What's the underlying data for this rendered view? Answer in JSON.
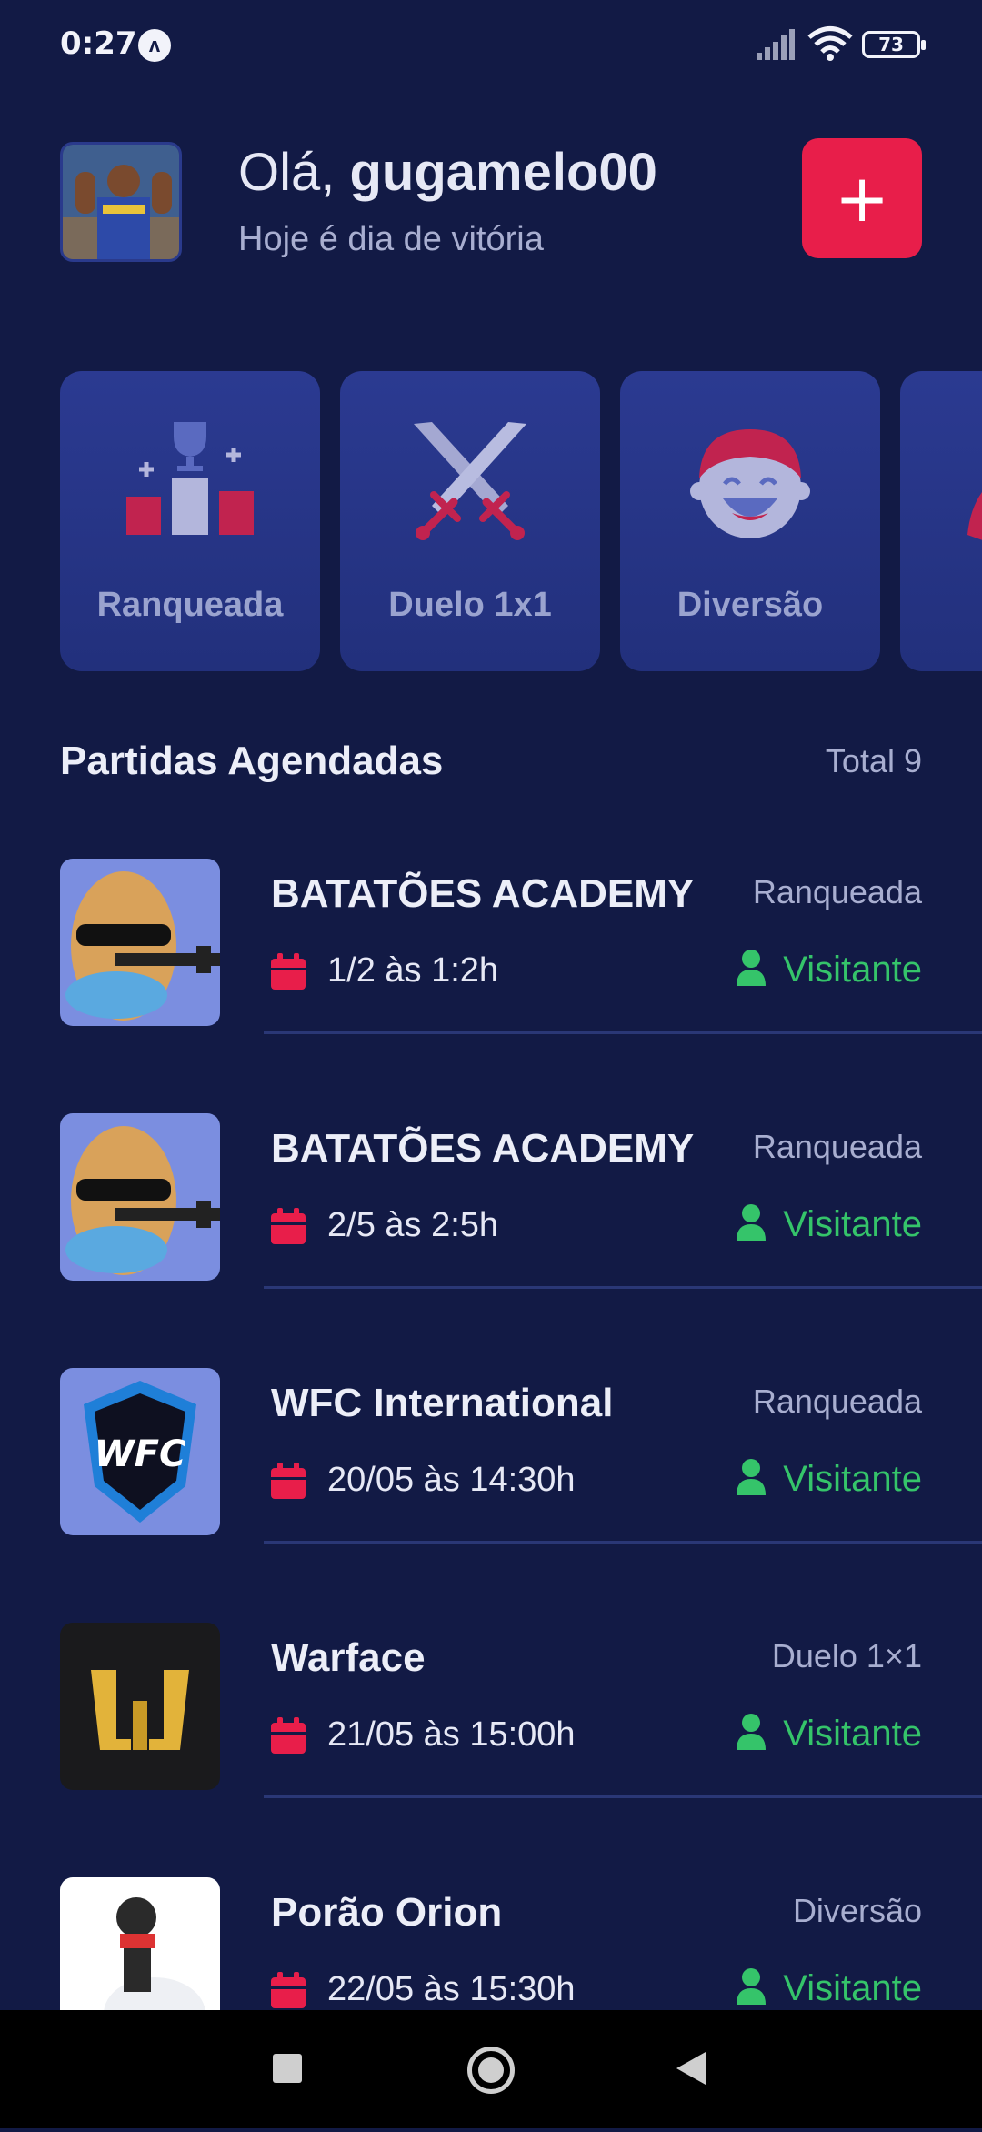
{
  "status_bar": {
    "time": "0:27",
    "app_icon_glyph": "ʌ",
    "battery": "73"
  },
  "header": {
    "greeting_prefix": "Olá, ",
    "username": "gugamelo00",
    "subtitle": "Hoje é dia de vitória",
    "add_label": "+",
    "accent_color": "#e81e4a"
  },
  "categories": [
    {
      "label": "Ranqueada",
      "icon": "trophy-podium-icon"
    },
    {
      "label": "Duelo 1x1",
      "icon": "crossed-swords-icon"
    },
    {
      "label": "Diversão",
      "icon": "laughing-face-icon"
    }
  ],
  "section": {
    "title": "Partidas Agendadas",
    "total": "Total 9"
  },
  "matches": [
    {
      "name": "BATATÕES ACADEMY",
      "mode": "Ranqueada",
      "date": "1/2 às 1:2h",
      "role": "Visitante",
      "logo": "potato-gangster-logo"
    },
    {
      "name": "BATATÕES ACADEMY",
      "mode": "Ranqueada",
      "date": "2/5 às 2:5h",
      "role": "Visitante",
      "logo": "potato-gangster-logo"
    },
    {
      "name": "WFC International",
      "mode": "Ranqueada",
      "date": "20/05 às 14:30h",
      "role": "Visitante",
      "logo": "wfc-shield-logo",
      "logo_text": "WFC"
    },
    {
      "name": "Warface",
      "mode": "Duelo 1×1",
      "date": "21/05 às 15:00h",
      "role": "Visitante",
      "logo": "warface-gold-logo"
    },
    {
      "name": "Porão Orion",
      "mode": "Diversão",
      "date": "22/05 às 15:30h",
      "role": "Visitante",
      "logo": "robot-hero-logo"
    }
  ],
  "colors": {
    "background": "#121a45",
    "card": "#2b3a91",
    "accent": "#e81e4a",
    "role_green": "#35c46a"
  }
}
